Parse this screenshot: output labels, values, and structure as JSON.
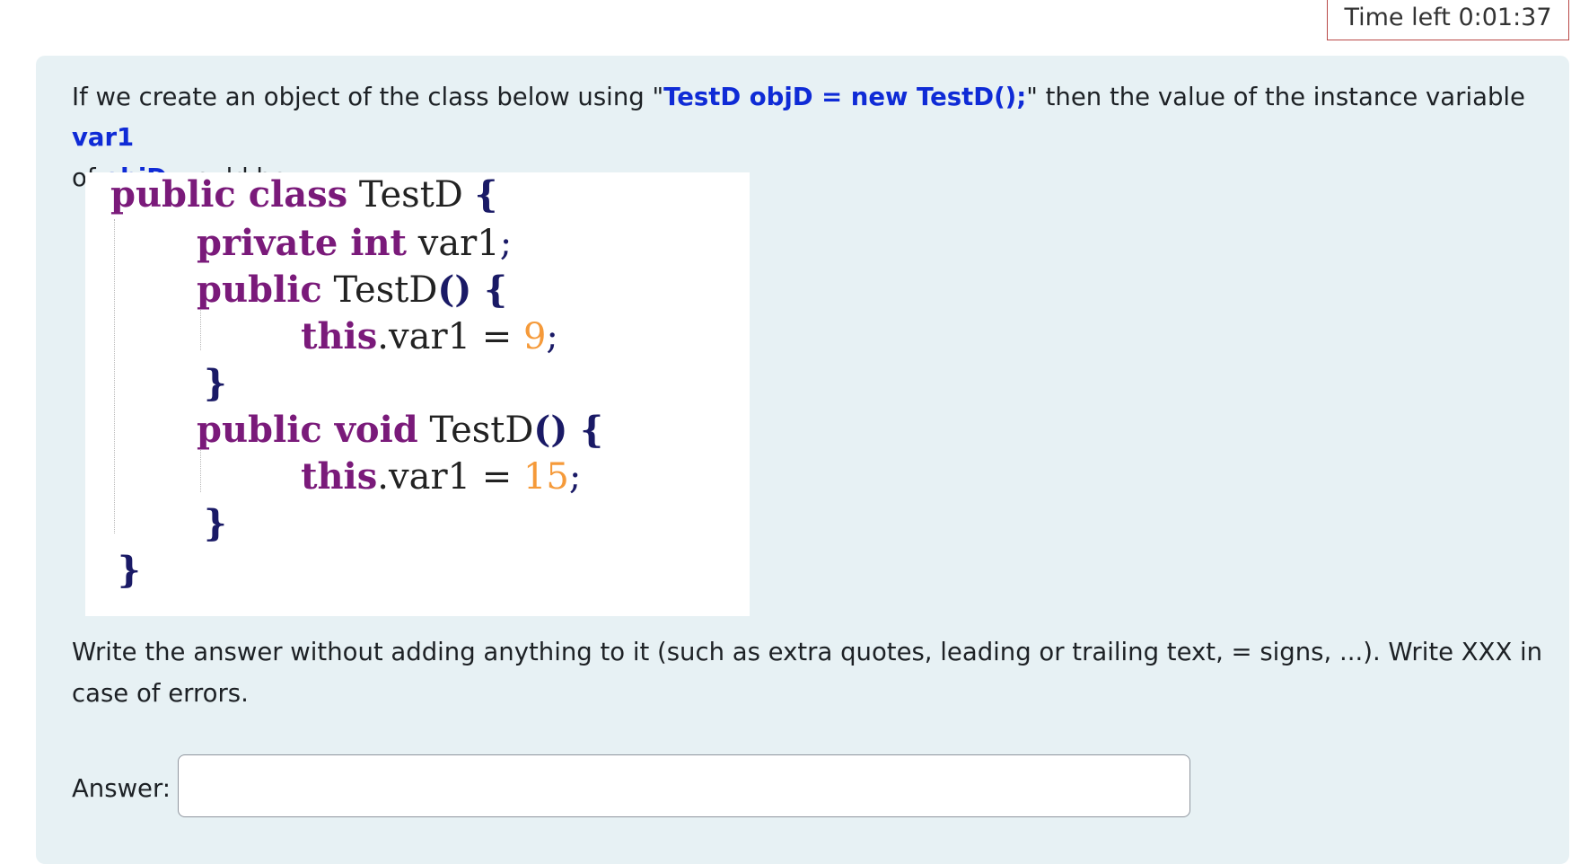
{
  "timer": {
    "label": "Time left 0:01:37"
  },
  "question": {
    "prompt_part1": "If we create an object of the class below using \"",
    "prompt_code": "TestD objD = new TestD();",
    "prompt_part2": "\" then the value of the instance variable ",
    "prompt_var": "var1",
    "prompt_part3": " of ",
    "prompt_obj": "objD",
    "prompt_part4": " would be:",
    "code_image": {
      "line1_kw": "public class",
      "line1_rest": " TestD ",
      "line1_brace": "{",
      "line2_kw": "private int",
      "line2_rest": " var1",
      "line2_punc": ";",
      "line3_kw": "public",
      "line3_rest": " TestD",
      "line3_parens": "()",
      "line3_brace": " {",
      "line4_kw": "this",
      "line4_rest": ".var1 = ",
      "line4_num": "9",
      "line4_punc": ";",
      "line5_brace": "}",
      "line6_kw": "public void",
      "line6_rest": " TestD",
      "line6_parens": "()",
      "line6_brace": " {",
      "line7_kw": "this",
      "line7_rest": ".var1 = ",
      "line7_num": "15",
      "line7_punc": ";",
      "line8_brace": "}",
      "line9_brace": "}"
    },
    "instruction": "Write the answer without adding anything to it (such as extra quotes, leading or trailing text, = signs, ...). Write XXX in case of errors."
  },
  "answer": {
    "label": "Answer:",
    "value": ""
  }
}
